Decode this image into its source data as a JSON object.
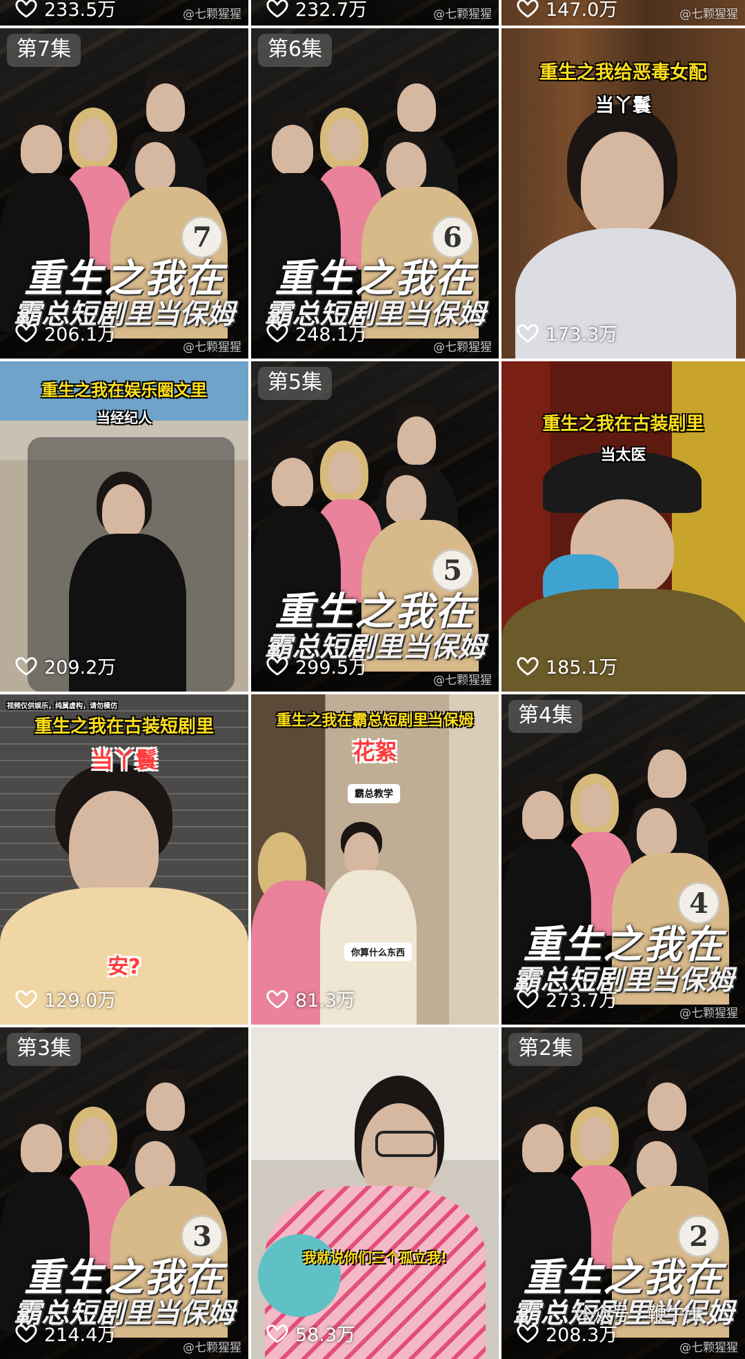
{
  "watermark": "@七颗猩猩",
  "top_row": [
    {
      "likes": "233.5万"
    },
    {
      "likes": "232.7万"
    },
    {
      "likes": "147.0万"
    }
  ],
  "videos": [
    {
      "episode": "第7集",
      "number": "7",
      "title_line1": "重生之我在",
      "title_line2": "霸总短剧里当保姆",
      "likes": "206.1万"
    },
    {
      "episode": "第6集",
      "number": "6",
      "title_line1": "重生之我在",
      "title_line2": "霸总短剧里当保姆",
      "likes": "248.1万"
    },
    {
      "caption": "重生之我给恶毒女配",
      "subcaption": "当丫鬟",
      "likes": "173.3万"
    },
    {
      "caption": "重生之我在娱乐圈文里",
      "subcaption": "当经纪人",
      "likes": "209.2万"
    },
    {
      "episode": "第5集",
      "number": "5",
      "title_line1": "重生之我在",
      "title_line2": "霸总短剧里当保姆",
      "likes": "299.5万"
    },
    {
      "caption": "重生之我在古装剧里",
      "subcaption": "当太医",
      "likes": "185.1万"
    },
    {
      "disclaimer": "视频仅供娱乐，纯属虚构，请勿模仿",
      "caption": "重生之我在古装短剧里",
      "subcaption": "当丫鬟",
      "bubble": "安?",
      "likes": "129.0万"
    },
    {
      "caption": "重生之我在霸总短剧里当保姆",
      "subcaption": "花絮",
      "tag": "霸总教学",
      "line": "你算什么东西",
      "likes": "81.3万"
    },
    {
      "episode": "第4集",
      "number": "4",
      "title_line1": "重生之我在",
      "title_line2": "霸总短剧里当保姆",
      "likes": "273.7万"
    },
    {
      "episode": "第3集",
      "number": "3",
      "title_line1": "重生之我在",
      "title_line2": "霸总短剧里当保姆",
      "likes": "214.4万"
    },
    {
      "bubble": "我就说你们三个孤立我!",
      "likes": "58.3万"
    },
    {
      "episode": "第2集",
      "number": "2",
      "title_line1": "重生之我在",
      "title_line2": "霸总短剧里当保姆",
      "likes": "208.3万",
      "wechat": "公众号 · 鞭牛士"
    }
  ]
}
